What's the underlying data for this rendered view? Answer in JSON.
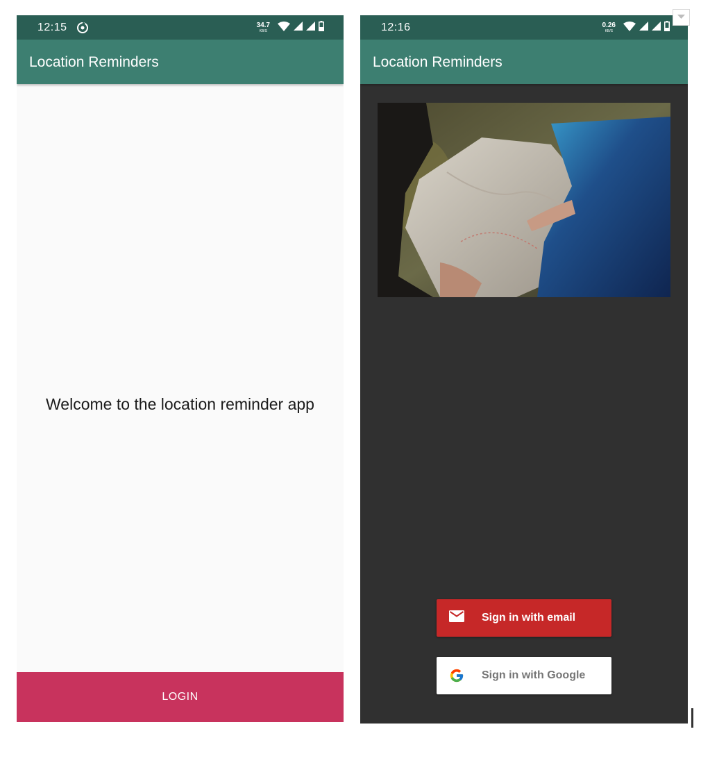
{
  "left_screen": {
    "status": {
      "time": "12:15",
      "speed_value": "34.7",
      "speed_unit": "KB/S"
    },
    "app_title": "Location Reminders",
    "welcome_text": "Welcome to the location reminder app",
    "login_label": "LOGIN"
  },
  "right_screen": {
    "status": {
      "time": "12:16",
      "speed_value": "0.26",
      "speed_unit": "KB/S"
    },
    "app_title": "Location Reminders",
    "email_button_label": "Sign in with email",
    "google_button_label": "Sign in with Google"
  },
  "colors": {
    "statusbar": "#2a5e54",
    "appbar": "#3d7f71",
    "login_button": "#c8335d",
    "email_button": "#c62828",
    "auth_background": "#303030",
    "left_background": "#fafafa"
  }
}
